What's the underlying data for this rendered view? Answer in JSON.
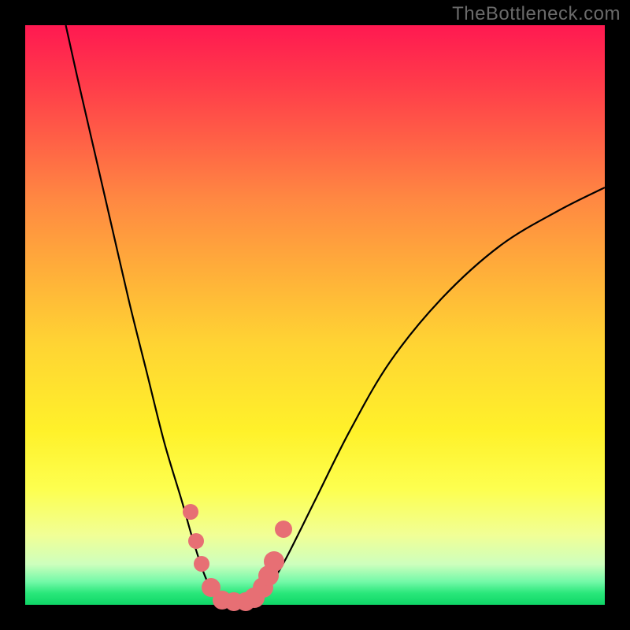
{
  "watermark": "TheBottleneck.com",
  "chart_data": {
    "type": "line",
    "title": "",
    "xlabel": "",
    "ylabel": "",
    "xlim": [
      0,
      100
    ],
    "ylim": [
      0,
      100
    ],
    "background_gradient": {
      "stops": [
        {
          "pos": 0,
          "color": "#ff1951"
        },
        {
          "pos": 10,
          "color": "#ff3b4a"
        },
        {
          "pos": 20,
          "color": "#ff6146"
        },
        {
          "pos": 30,
          "color": "#ff8842"
        },
        {
          "pos": 42,
          "color": "#ffad3a"
        },
        {
          "pos": 55,
          "color": "#ffd433"
        },
        {
          "pos": 70,
          "color": "#fff12a"
        },
        {
          "pos": 80,
          "color": "#fdff4f"
        },
        {
          "pos": 88,
          "color": "#f1ff96"
        },
        {
          "pos": 93,
          "color": "#cdffbd"
        },
        {
          "pos": 96,
          "color": "#74f9a8"
        },
        {
          "pos": 98,
          "color": "#29e77a"
        },
        {
          "pos": 100,
          "color": "#0fd667"
        }
      ]
    },
    "series": [
      {
        "name": "bottleneck-curve",
        "color": "#000000",
        "points": [
          {
            "x": 7,
            "y": 100
          },
          {
            "x": 9,
            "y": 91
          },
          {
            "x": 12,
            "y": 78
          },
          {
            "x": 15,
            "y": 65
          },
          {
            "x": 18,
            "y": 52
          },
          {
            "x": 21,
            "y": 40
          },
          {
            "x": 24,
            "y": 28
          },
          {
            "x": 27,
            "y": 18
          },
          {
            "x": 29,
            "y": 11
          },
          {
            "x": 31,
            "y": 5
          },
          {
            "x": 33,
            "y": 1
          },
          {
            "x": 35,
            "y": 0
          },
          {
            "x": 38,
            "y": 0
          },
          {
            "x": 40,
            "y": 1
          },
          {
            "x": 42,
            "y": 3
          },
          {
            "x": 45,
            "y": 8
          },
          {
            "x": 50,
            "y": 18
          },
          {
            "x": 56,
            "y": 30
          },
          {
            "x": 63,
            "y": 42
          },
          {
            "x": 72,
            "y": 53
          },
          {
            "x": 82,
            "y": 62
          },
          {
            "x": 92,
            "y": 68
          },
          {
            "x": 100,
            "y": 72
          }
        ]
      }
    ],
    "markers": {
      "color": "#e76f74",
      "points": [
        {
          "x": 28.5,
          "y": 16,
          "r": 10
        },
        {
          "x": 29.5,
          "y": 11,
          "r": 10
        },
        {
          "x": 30.5,
          "y": 7,
          "r": 10
        },
        {
          "x": 32.0,
          "y": 3,
          "r": 12
        },
        {
          "x": 34.0,
          "y": 0.8,
          "r": 12
        },
        {
          "x": 36.0,
          "y": 0.5,
          "r": 12
        },
        {
          "x": 38.0,
          "y": 0.5,
          "r": 12
        },
        {
          "x": 39.5,
          "y": 1.2,
          "r": 13
        },
        {
          "x": 41.0,
          "y": 3.0,
          "r": 13
        },
        {
          "x": 42.0,
          "y": 5.0,
          "r": 13
        },
        {
          "x": 43.0,
          "y": 7.5,
          "r": 13
        },
        {
          "x": 44.5,
          "y": 13.0,
          "r": 11
        }
      ]
    }
  }
}
